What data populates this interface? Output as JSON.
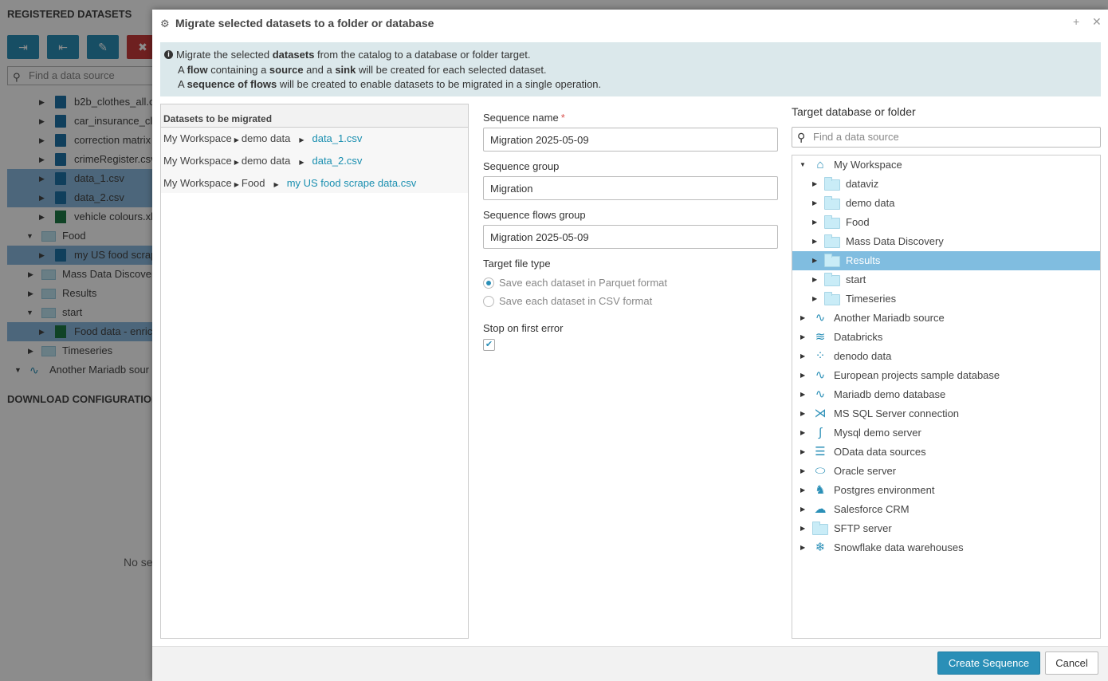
{
  "background": {
    "panel_title": "REGISTERED DATASETS",
    "search_placeholder": "Find a data source",
    "tree_items": [
      "b2b_clothes_all.c",
      "car_insurance_cla",
      "correction matrix",
      "crimeRegister.csv",
      "data_1.csv",
      "data_2.csv",
      "vehicle colours.xl",
      "Food",
      "my US food scrap",
      "Mass Data Discover",
      "Results",
      "start",
      "Food data - enric",
      "Timeseries",
      "Another Mariadb sour"
    ],
    "download_title": "DOWNLOAD CONFIGURATION",
    "no_selection": "No sel"
  },
  "dialog": {
    "title": "Migrate selected datasets to a folder or database",
    "info": {
      "l1_a": "Migrate the selected ",
      "l1_b": "datasets",
      "l1_c": " from the catalog to a database or folder target.",
      "l2_a": "A ",
      "l2_b": "flow",
      "l2_c": " containing a ",
      "l2_d": "source",
      "l2_e": " and a ",
      "l2_f": "sink",
      "l2_g": " will be created for each selected dataset.",
      "l3_a": "A ",
      "l3_b": "sequence of flows",
      "l3_c": " will be created to enable datasets to be migrated in a single operation."
    },
    "datasets": {
      "header": "Datasets to be migrated",
      "rows": [
        {
          "workspace": "My Workspace",
          "folder": "demo data",
          "file": "data_1.csv"
        },
        {
          "workspace": "My Workspace",
          "folder": "demo data",
          "file": "data_2.csv"
        },
        {
          "workspace": "My Workspace",
          "folder": "Food",
          "file": "my US food scrape data.csv"
        }
      ]
    },
    "form": {
      "sequence_name_label": "Sequence name",
      "required_mark": "*",
      "sequence_name_value": "Migration 2025-05-09",
      "sequence_group_label": "Sequence group",
      "sequence_group_value": "Migration",
      "flows_group_label": "Sequence flows group",
      "flows_group_value": "Migration 2025-05-09",
      "file_type_label": "Target file type",
      "opt_parquet": "Save each dataset in Parquet format",
      "opt_csv": "Save each dataset in CSV format",
      "selected_file_type": "parquet",
      "stop_label": "Stop on first error",
      "stop_checked": true
    },
    "target": {
      "label": "Target database or folder",
      "search_placeholder": "Find a data source",
      "workspace": "My Workspace",
      "folders": [
        "dataviz",
        "demo data",
        "Food",
        "Mass Data Discovery",
        "Results",
        "start",
        "Timeseries"
      ],
      "selected_folder": "Results",
      "sources": [
        {
          "label": "Another Mariadb source",
          "icon": "mariadb-icon"
        },
        {
          "label": "Databricks",
          "icon": "databricks-icon"
        },
        {
          "label": "denodo data",
          "icon": "denodo-icon"
        },
        {
          "label": "European projects sample database",
          "icon": "mariadb-icon"
        },
        {
          "label": "Mariadb demo database",
          "icon": "mariadb-icon"
        },
        {
          "label": "MS SQL Server connection",
          "icon": "mssql-icon"
        },
        {
          "label": "Mysql demo server",
          "icon": "mysql-icon"
        },
        {
          "label": "OData data sources",
          "icon": "odata-icon"
        },
        {
          "label": "Oracle server",
          "icon": "oracle-icon"
        },
        {
          "label": "Postgres environment",
          "icon": "postgres-icon"
        },
        {
          "label": "Salesforce CRM",
          "icon": "salesforce-icon"
        },
        {
          "label": "SFTP server",
          "icon": "sftp-icon"
        },
        {
          "label": "Snowflake data warehouses",
          "icon": "snowflake-icon"
        }
      ]
    },
    "footer": {
      "create_label": "Create Sequence",
      "cancel_label": "Cancel"
    }
  },
  "colors": {
    "accent": "#2a8fb7",
    "link": "#1a8fb0",
    "selection": "#80bde0",
    "info_bg": "#dbe8eb"
  }
}
